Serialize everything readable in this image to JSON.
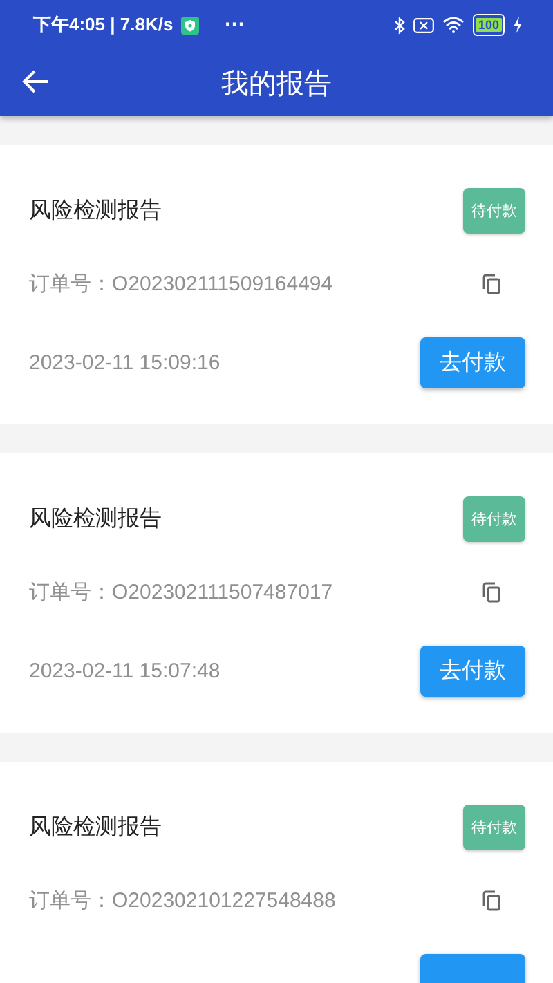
{
  "status_bar": {
    "time": "下午4:05 | 7.8K/s",
    "more": "···",
    "battery": "100"
  },
  "header": {
    "title": "我的报告"
  },
  "orders": [
    {
      "title": "风险检测报告",
      "status": "待付款",
      "order_label": "订单号：",
      "order_no": "O202302111509164494",
      "date": "2023-02-11 15:09:16",
      "action": "去付款"
    },
    {
      "title": "风险检测报告",
      "status": "待付款",
      "order_label": "订单号：",
      "order_no": "O202302111507487017",
      "date": "2023-02-11 15:07:48",
      "action": "去付款"
    },
    {
      "title": "风险检测报告",
      "status": "待付款",
      "order_label": "订单号：",
      "order_no": "O202302101227548488"
    }
  ]
}
